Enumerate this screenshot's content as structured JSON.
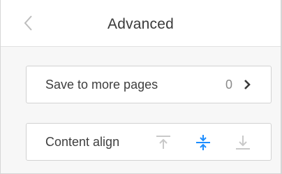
{
  "header": {
    "title": "Advanced",
    "back_icon": "chevron-left-icon"
  },
  "save_to_pages": {
    "label": "Save to more pages",
    "count": "0",
    "arrow_icon": "chevron-right-icon"
  },
  "content_align": {
    "label": "Content align",
    "options": [
      {
        "icon": "align-top-icon",
        "selected": false
      },
      {
        "icon": "align-middle-icon",
        "selected": true
      },
      {
        "icon": "align-bottom-icon",
        "selected": false
      }
    ]
  },
  "colors": {
    "accent": "#1a8cff",
    "icon_inactive": "#c9c9c9",
    "text": "#3e3e3e",
    "muted_text": "#8a8a8a",
    "background": "#f7f7f7",
    "card": "#ffffff"
  }
}
